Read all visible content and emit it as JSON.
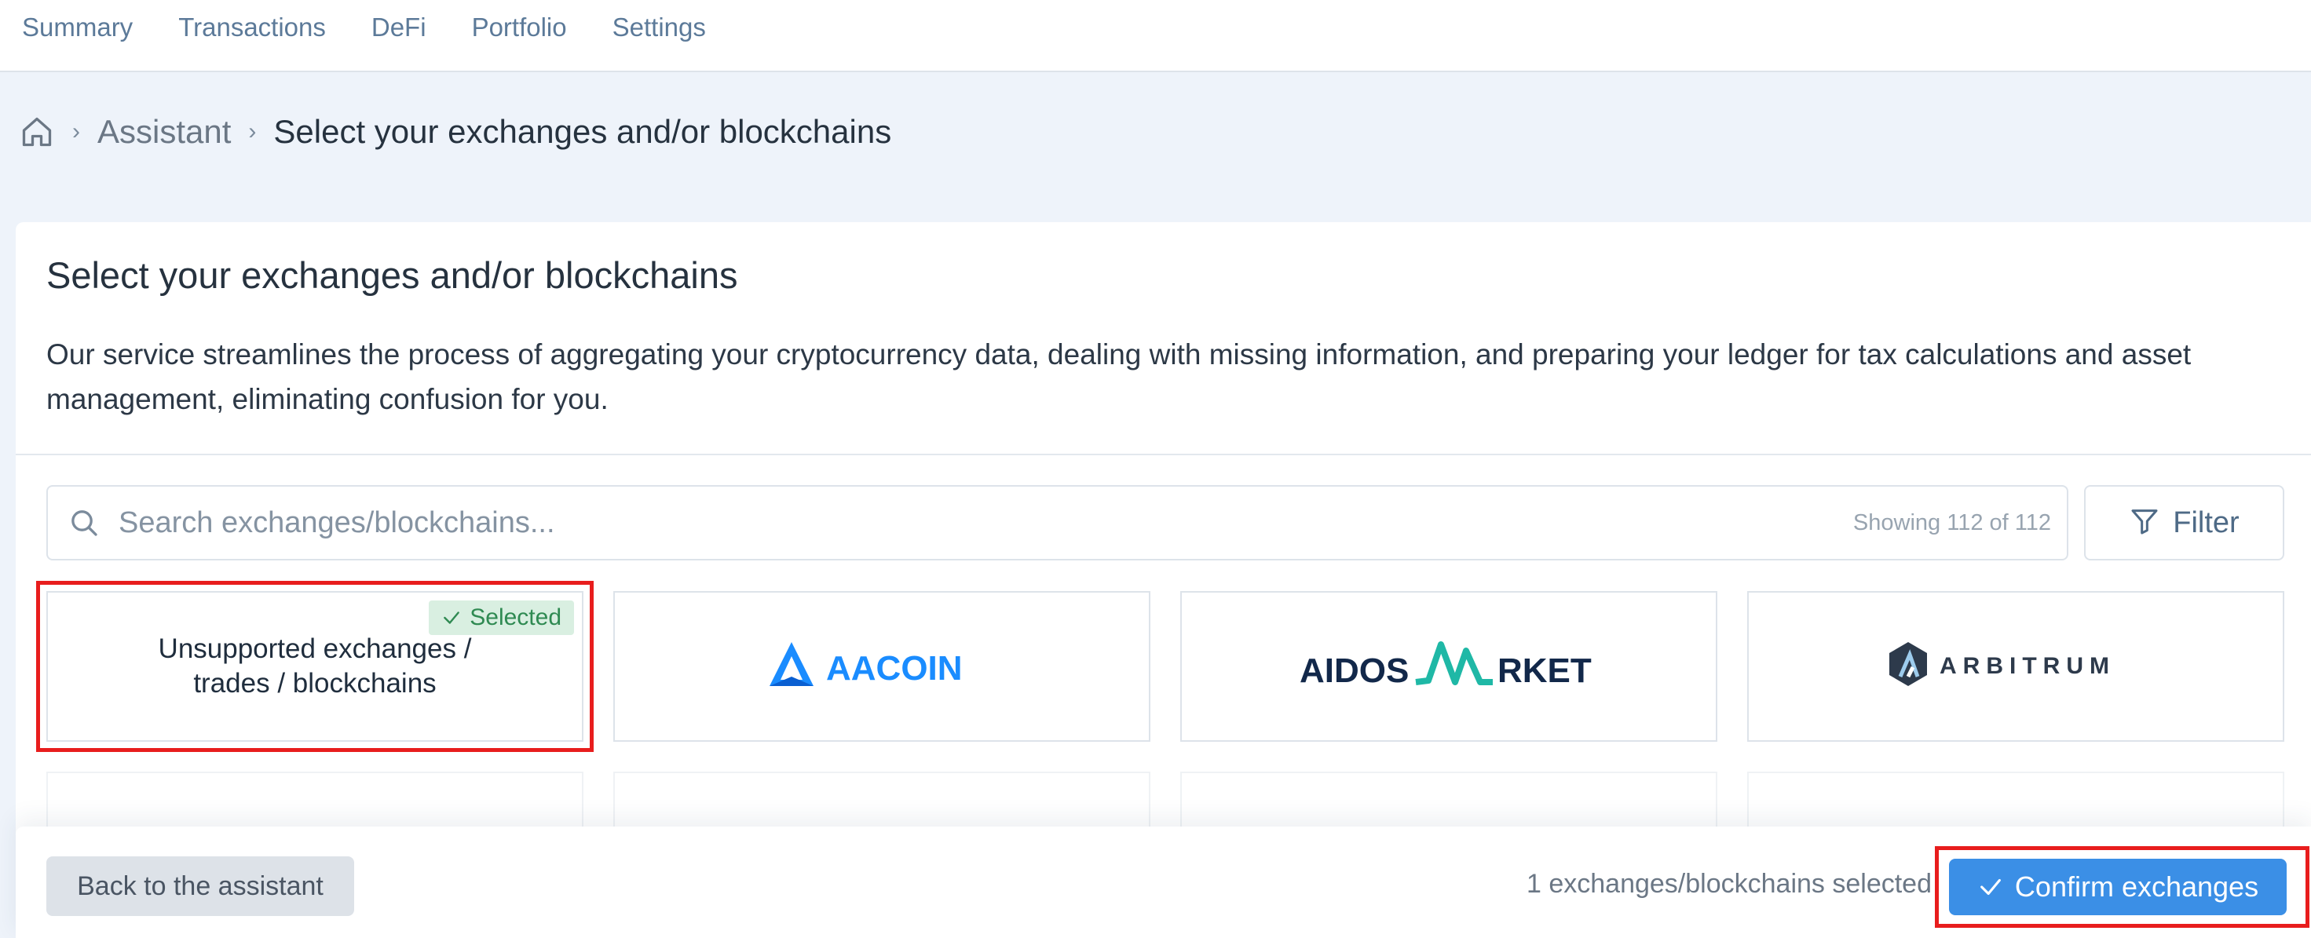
{
  "nav": {
    "items": [
      "Summary",
      "Transactions",
      "DeFi",
      "Portfolio",
      "Settings"
    ]
  },
  "breadcrumb": {
    "home_icon": "home-icon",
    "link": "Assistant",
    "current": "Select your exchanges and/or blockchains"
  },
  "card": {
    "title": "Select your exchanges and/or blockchains",
    "description": "Our service streamlines the process of aggregating your cryptocurrency data, dealing with missing information, and preparing your ledger for tax calculations and asset management, eliminating confusion for you."
  },
  "search": {
    "placeholder": "Search exchanges/blockchains...",
    "count": "Showing 112 of 112"
  },
  "filter": {
    "label": "Filter"
  },
  "tiles": [
    {
      "text": "Unsupported exchanges / trades / blockchains",
      "badge": "Selected"
    },
    {
      "logo_text": "AACOIN",
      "color": "#1a8cff"
    },
    {
      "logo_text_1": "AIDOS",
      "logo_text_2": "RKET",
      "color": "#12284a",
      "accent": "#1fb8a6"
    },
    {
      "logo_text": "ARBITRUM",
      "color": "#2d3a4b"
    }
  ],
  "footer": {
    "back_label": "Back to the assistant",
    "selected_count": "1 exchanges/blockchains selected",
    "confirm_label": "Confirm exchanges"
  },
  "colors": {
    "primary": "#3b8fe6",
    "highlight": "#e81d1d",
    "badge_bg": "#d9efe1",
    "badge_text": "#2f8a52"
  }
}
